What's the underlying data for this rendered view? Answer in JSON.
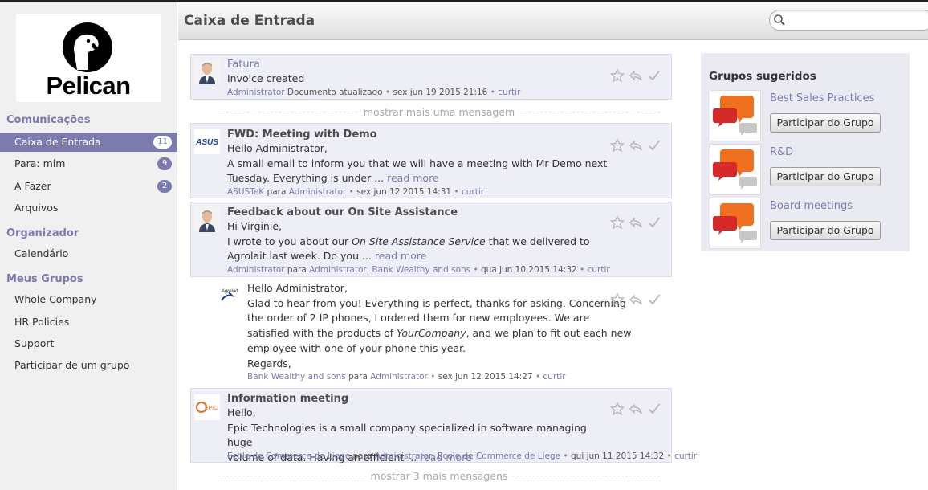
{
  "header": {
    "title": "Caixa de Entrada",
    "search_placeholder": ""
  },
  "brand": {
    "logo_text": "Pelican"
  },
  "sidebar": {
    "sections": [
      {
        "label": "Comunicações"
      },
      {
        "label": "Organizador"
      },
      {
        "label": "Meus Grupos"
      }
    ],
    "items": [
      {
        "label": "Caixa de Entrada",
        "badge": "11"
      },
      {
        "label": "Para: mim",
        "badge": "9"
      },
      {
        "label": "A Fazer",
        "badge": "2"
      },
      {
        "label": "Arquivos"
      },
      {
        "label": "Calendário"
      },
      {
        "label": "Whole Company"
      },
      {
        "label": "HR Policies"
      },
      {
        "label": "Support"
      },
      {
        "label": "Participar de um grupo"
      }
    ]
  },
  "messages": [
    {
      "title": "Fatura",
      "body": "Invoice created",
      "author": "Administrator",
      "meta_text": "Documento atualizado",
      "date": "sex jun 19 2015 21:16",
      "like": "curtir"
    },
    {
      "title": "FWD: Meeting with Demo",
      "body": [
        "Hello Administrator,",
        "A small email to inform you that we will have a meeting with Mr Demo next",
        "Tuesday. Everything is under ..."
      ],
      "read_more": "read more",
      "author": "ASUSTeK",
      "to_word": "para",
      "recipients": [
        "Administrator"
      ],
      "date": "sex jun 12 2015 14:31",
      "like": "curtir",
      "logo": "ASUS"
    },
    {
      "title": "Feedback about our On Site Assistance",
      "body": [
        "Hi Virginie,",
        "I wrote to you about our",
        "On Site Assistance Service",
        "that we delivered to",
        "Agrolait last week. Do you ..."
      ],
      "read_more": "read more",
      "author": "Administrator",
      "to_word": "para",
      "recipients": [
        "Administrator",
        "Bank Wealthy and sons"
      ],
      "date": "qua jun 10 2015 14:32",
      "like": "curtir"
    },
    {
      "body": [
        "Hello Administrator,",
        "Glad to hear from you! Everything is perfect, thanks for asking. Concerning",
        "the order of 2 IP phones, I ordered them for new employees. We are",
        "satisfied with the products of",
        "YourCompany",
        ", and we plan to fit out each new",
        "employee with one of your phone this year.",
        "Regards,"
      ],
      "author": "Bank Wealthy and sons",
      "to_word": "para",
      "recipients": [
        "Administrator"
      ],
      "date": "sex jun 12 2015 14:27",
      "like": "curtir",
      "logo": "Agrolait"
    },
    {
      "title": "Information meeting",
      "body": [
        "Hello,",
        "Epic Technologies is a small company specialized in software managing huge",
        "volume of data. Having an efficient ..."
      ],
      "read_more": "read more",
      "author": "Ecole de Commerce de Liege",
      "to_word": "para",
      "recipients": [
        "Administrator",
        "Ecole de Commerce de Liege"
      ],
      "date": "qui jun 11 2015 14:32",
      "like": "curtir",
      "logo": "EPIC"
    }
  ],
  "separators": [
    "mostrar mais uma mensagem",
    "mostrar 3 mais mensagens"
  ],
  "groups": {
    "title": "Grupos sugeridos",
    "items": [
      {
        "name": "Best Sales Practices",
        "button": "Participar do Grupo"
      },
      {
        "name": "R&D",
        "button": "Participar do Grupo"
      },
      {
        "name": "Board meetings",
        "button": "Participar do Grupo"
      }
    ]
  },
  "colors": {
    "accent": "#7c7bad",
    "message_bg": "#eeeef6",
    "groups_bg": "#eaeaf3",
    "bubble_orange": "#f07020",
    "bubble_red": "#d42a2a"
  }
}
